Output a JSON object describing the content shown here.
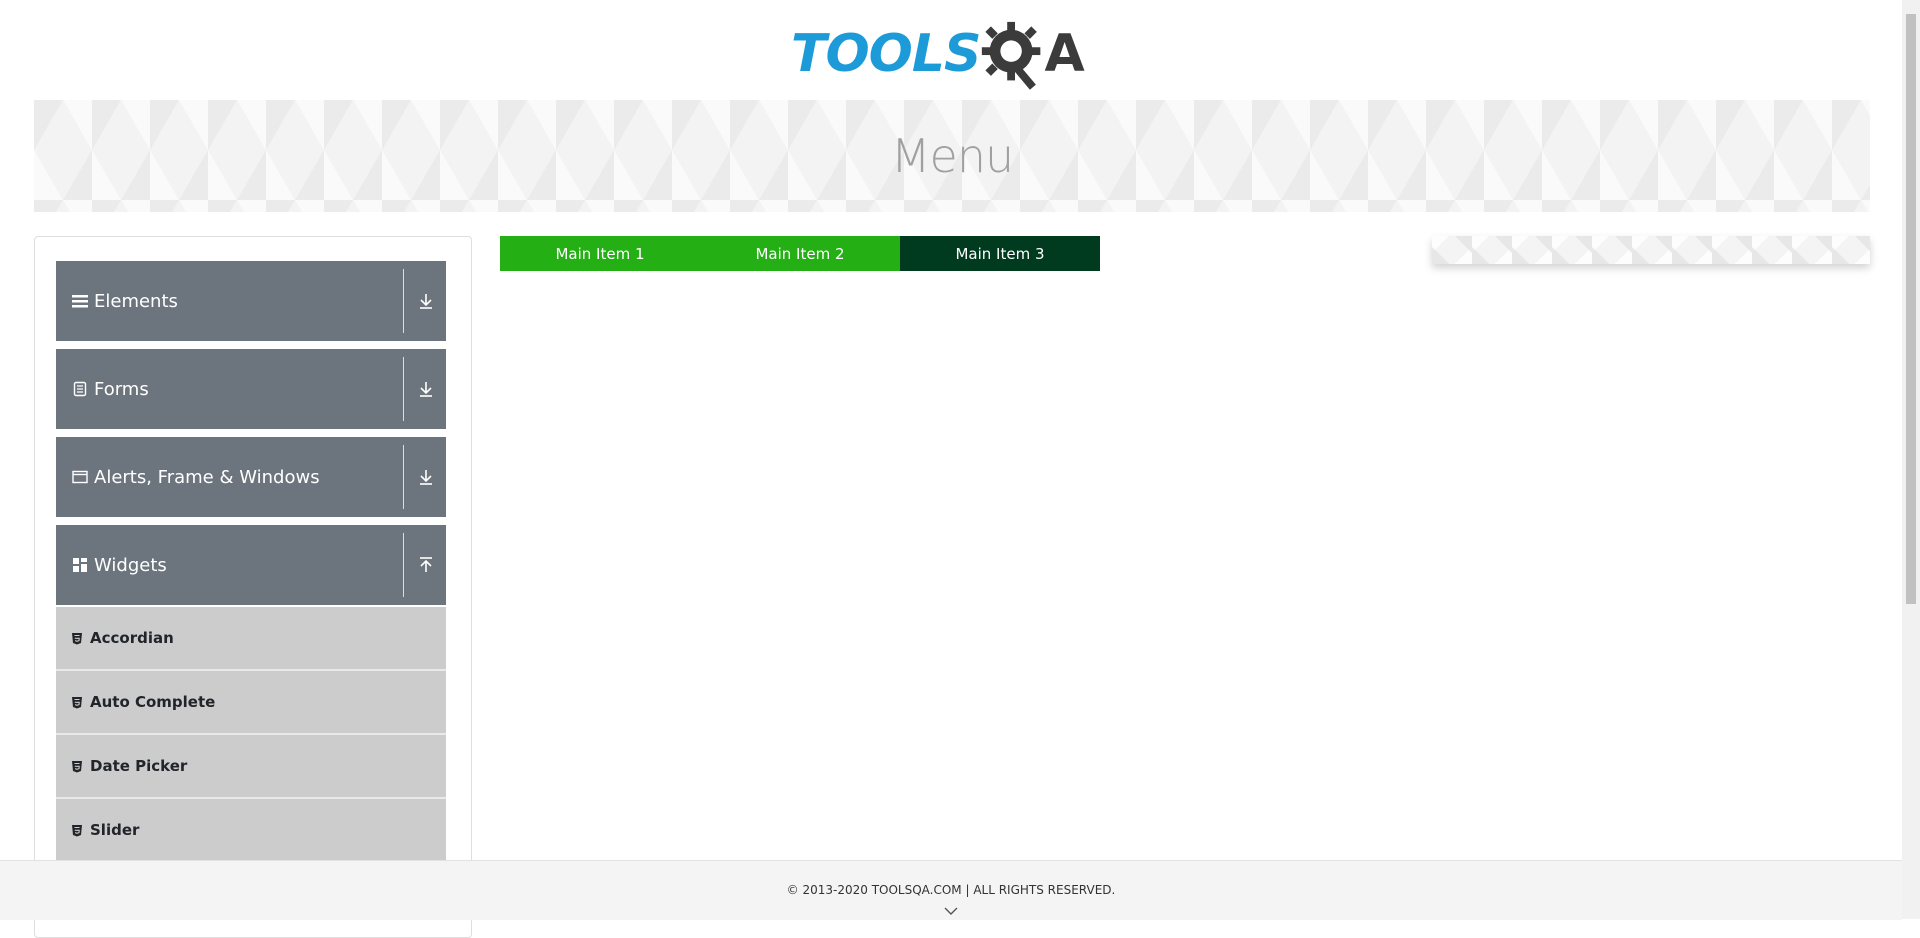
{
  "header": {
    "logo_text_primary": "TOOLS",
    "logo_text_secondary": "A",
    "logo_alt": "TOOLSQA"
  },
  "banner": {
    "title": "Menu"
  },
  "sidebar": {
    "groups": [
      {
        "label": "Elements",
        "icon": "hamburger-icon",
        "expanded": false
      },
      {
        "label": "Forms",
        "icon": "document-icon",
        "expanded": false
      },
      {
        "label": "Alerts, Frame & Windows",
        "icon": "window-icon",
        "expanded": false
      },
      {
        "label": "Widgets",
        "icon": "grid-icon",
        "expanded": true
      }
    ],
    "widgets_items": [
      {
        "label": "Accordian",
        "icon": "html5-icon"
      },
      {
        "label": "Auto Complete",
        "icon": "html5-icon"
      },
      {
        "label": "Date Picker",
        "icon": "html5-icon"
      },
      {
        "label": "Slider",
        "icon": "html5-icon"
      }
    ]
  },
  "nav": {
    "items": [
      {
        "label": "Main Item 1",
        "active": false
      },
      {
        "label": "Main Item 2",
        "active": false
      },
      {
        "label": "Main Item 3",
        "active": true
      }
    ]
  },
  "footer": {
    "copyright": "© 2013-2020 TOOLSQA.COM | ALL RIGHTS RESERVED."
  },
  "colors": {
    "logo_blue": "#1c9bd8",
    "logo_dark": "#3b3b3b",
    "group_bg": "#6c757d",
    "sub_item_bg": "#cccccc",
    "nav_green": "#24af15",
    "nav_active": "#003a1f"
  }
}
